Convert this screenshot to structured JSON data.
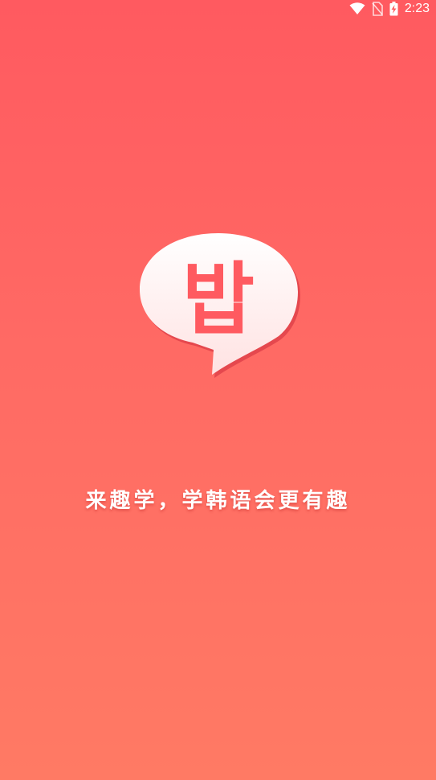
{
  "status_bar": {
    "time": "2:23",
    "icons": [
      "wifi-icon",
      "no-sim-icon",
      "battery-charging-icon"
    ]
  },
  "logo": {
    "glyph": "밥",
    "icon": "speech-bubble-icon",
    "colors": {
      "bubble_top": "#FFFFFF",
      "bubble_bottom": "#FFE2E2",
      "glyph": "#FF5A60"
    }
  },
  "slogan": "来趣学，学韩语会更有趣",
  "colors": {
    "background_top": "#FF5A60",
    "background_bottom": "#FF7A64"
  }
}
